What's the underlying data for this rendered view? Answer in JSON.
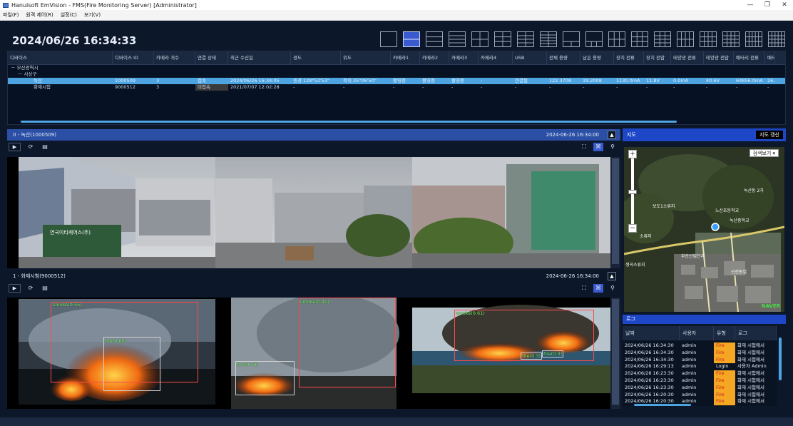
{
  "window": {
    "title": "Hanulsoft EmVision - FMS(Fire Monitoring Server) [Administrator]",
    "controls": [
      "—",
      "❐",
      "✕"
    ]
  },
  "menu": [
    "파일(F)",
    "원격 제어(R)",
    "설정(C)",
    "보기(V)"
  ],
  "header": {
    "datetime": "2024/06/26 16:34:33"
  },
  "layout_buttons": {
    "count": 18,
    "active_index": 1
  },
  "device_table": {
    "columns": [
      "디바이스",
      "디바이스 ID",
      "카메라 개수",
      "연결 상태",
      "최근 수신일",
      "경도",
      "위도",
      "카메라1",
      "카메라2",
      "카메라3",
      "카메라4",
      "USB",
      "전체 용량",
      "남은 용량",
      "장치 전류",
      "장치 전압",
      "태양광 전류",
      "태양광 전압",
      "배터리 전류",
      "배터"
    ],
    "tree": [
      "－ 부산광역시",
      "－ 사상구"
    ],
    "rows": [
      [
        "녹산",
        "1000509",
        "3",
        "접속",
        "2024/06/26 16:34:05",
        "동경 128°52'53\"",
        "북위 35°06'50\"",
        "촬영중",
        "촬영중",
        "촬영중",
        "-",
        "연결됨",
        "122.3708",
        "19.2008",
        "1130.0mA",
        "11.8V",
        "0.0mA",
        "40.6V",
        "64856.0mA",
        "26.8"
      ],
      [
        "화재시험",
        "9000512",
        "3",
        "미접속",
        "2021/07/07 12:02:28",
        "-",
        "-",
        "-",
        "-",
        "-",
        "-",
        "-",
        "-",
        "-",
        "-",
        "-",
        "-",
        "-",
        "-",
        "-"
      ]
    ]
  },
  "panel0": {
    "title": "0 - 녹산(1000509)",
    "timestamp": "2024-06-26 16:34:00"
  },
  "panel1": {
    "title": "1 - 화재시험(9000512)",
    "timestamp": "2024-06-26 16:34:00",
    "detections": [
      {
        "label": "smoke(0.55)"
      },
      {
        "label": "fire(0.60)"
      },
      {
        "label": "smoke(0.40)"
      },
      {
        "label": "fire(0.73)"
      },
      {
        "label": "smoke(0.61)"
      },
      {
        "label": "fire(0.3)"
      },
      {
        "label": "fire(0.3)"
      }
    ]
  },
  "building_sign": "연국이티케어스(주)",
  "map": {
    "title": "지도",
    "refresh_label": "지도 갱신",
    "view_label": "검색보기 ▾",
    "zoom_in": "+",
    "zoom_out": "−",
    "brand": "NAVER",
    "places": [
      "노산초등학교",
      "녹산중학교",
      "녹산동 2가",
      "소류지",
      "부산산업단지",
      "생곡소류지",
      "선진동업",
      "보도1소류지"
    ]
  },
  "log": {
    "title": "로그",
    "columns": [
      "날짜",
      "사용자",
      "유형",
      "로그"
    ],
    "rows": [
      [
        "2024/06/26 16:34:30",
        "admin",
        "Fire",
        "화재 시험에서"
      ],
      [
        "2024/06/26 16:34:30",
        "admin",
        "Fire",
        "화재 시험에서"
      ],
      [
        "2024/06/26 16:34:30",
        "admin",
        "Fire",
        "화재 시험에서"
      ],
      [
        "2024/06/26 16:29:13",
        "admin",
        "Login",
        "사용자 Admin"
      ],
      [
        "2024/06/26 16:23:30",
        "admin",
        "Fire",
        "화재 시험에서"
      ],
      [
        "2024/06/26 16:23:30",
        "admin",
        "Fire",
        "화재 시험에서"
      ],
      [
        "2024/06/26 16:23:30",
        "admin",
        "Fire",
        "화재 시험에서"
      ],
      [
        "2024/06/26 16:20:30",
        "admin",
        "Fire",
        "화재 시험에서"
      ],
      [
        "2024/06/26 16:20:30",
        "admin",
        "Fire",
        "화재 시험에서"
      ]
    ]
  },
  "colors": {
    "accent": "#2a4fa5",
    "selected_row": "#4ea4e0",
    "fire_badge": "#f5a623",
    "detect_box": "#ff4a4a",
    "detect_label": "#7cff6a"
  }
}
